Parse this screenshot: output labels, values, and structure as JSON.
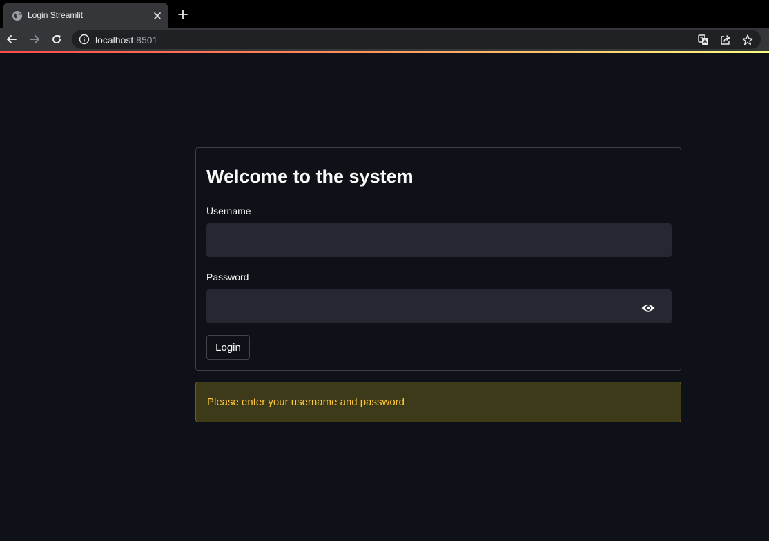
{
  "browser": {
    "tab_title": "Login Streamlit",
    "url_host": "localhost",
    "url_port": ":8501",
    "icons": [
      "globe-icon",
      "close-icon",
      "plus-icon",
      "back-arrow-icon",
      "forward-arrow-icon",
      "reload-icon",
      "info-icon",
      "translate-icon",
      "share-icon",
      "star-icon"
    ]
  },
  "form": {
    "title": "Welcome to the system",
    "username_label": "Username",
    "username_value": "",
    "password_label": "Password",
    "password_value": "",
    "login_label": "Login"
  },
  "alert": {
    "message": "Please enter your username and password"
  },
  "colors": {
    "background": "#0e1117",
    "input_bg": "#262730",
    "warning_bg": "#3d3a1a",
    "warning_text": "#ffc83d"
  }
}
